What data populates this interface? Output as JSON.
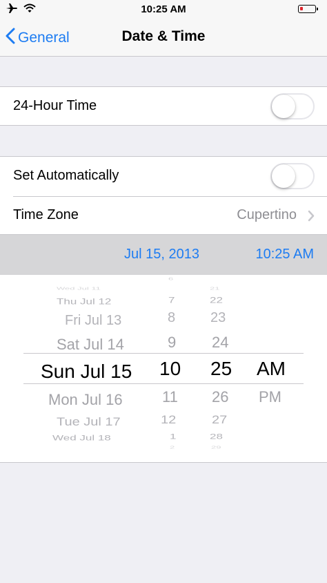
{
  "status_bar": {
    "time": "10:25 AM",
    "icons": [
      "airplane-icon",
      "wifi-icon",
      "battery-icon"
    ]
  },
  "nav": {
    "back_label": "General",
    "title": "Date & Time"
  },
  "settings": {
    "hour24_label": "24-Hour Time",
    "hour24_on": false,
    "set_auto_label": "Set Automatically",
    "set_auto_on": false,
    "timezone_label": "Time Zone",
    "timezone_value": "Cupertino"
  },
  "date_header": {
    "date": "Jul 15, 2013",
    "time": "10:25 AM"
  },
  "picker": {
    "dates": [
      "Wed Jul 11",
      "Thu Jul 12",
      "Fri Jul 13",
      "Sat Jul 14",
      "Sun Jul 15",
      "Mon Jul 16",
      "Tue Jul 17",
      "Wed Jul 18"
    ],
    "hours": [
      "6",
      "7",
      "8",
      "9",
      "10",
      "11",
      "12",
      "1",
      "2"
    ],
    "minutes": [
      "21",
      "22",
      "23",
      "24",
      "25",
      "26",
      "27",
      "28",
      "29"
    ],
    "periods": [
      "AM",
      "PM"
    ],
    "selected": {
      "date": "Sun Jul 15",
      "hour": "10",
      "minute": "25",
      "period": "AM"
    }
  },
  "colors": {
    "accent": "#1d7cf2",
    "background": "#efeff4",
    "separator": "#c8c7cc",
    "battery_low": "#e0262d"
  }
}
